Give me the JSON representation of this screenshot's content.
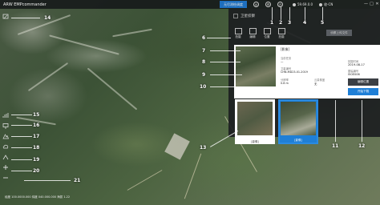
{
  "app": {
    "title": "ARW EMPcommander"
  },
  "topbar": {
    "tab_label": "无尽测绘调度",
    "status_label": "59.69.0.0",
    "user_label": "收-CN",
    "minimize": "—",
    "maximize": "□",
    "close": "✕"
  },
  "panel": {
    "header_label": "卫星侦察",
    "tools": [
      {
        "label": "拍摄"
      },
      {
        "label": "编辑"
      },
      {
        "label": "位置"
      },
      {
        "label": "拍摄"
      }
    ],
    "upload_label": "侦察上传文件"
  },
  "info_card": {
    "title": "[影像]",
    "fields": [
      {
        "label": "当前任务",
        "value": "—"
      },
      {
        "label": "卫星编号",
        "value": "CHN-MD23-01-2019"
      },
      {
        "label": "分辨率",
        "value": "0.8 m"
      },
      {
        "label": "云量覆盖",
        "value": "无"
      }
    ],
    "right_fields": [
      {
        "label": "拍摄时间",
        "value": "2019-08-17"
      },
      {
        "label": "图幅编号",
        "value": "I50E006"
      }
    ],
    "btn_dark": "编辑位置",
    "btn_blue": "开始下载"
  },
  "thumbnails": [
    {
      "caption": "[影像]",
      "selected": false
    },
    {
      "caption": "[影像]",
      "selected": true
    }
  ],
  "statusbar": {
    "coords": "经度 100.0000.000 纬度 040.000.000 海拔 1.22"
  },
  "callouts": [
    "1",
    "2",
    "3",
    "4",
    "5",
    "6",
    "7",
    "8",
    "9",
    "10",
    "11",
    "12",
    "13",
    "14",
    "15",
    "16",
    "17",
    "18",
    "19",
    "20",
    "21"
  ],
  "colors": {
    "accent": "#1f7fd6",
    "panel": "#1c1e21",
    "selected_border": "#2b8be0"
  }
}
